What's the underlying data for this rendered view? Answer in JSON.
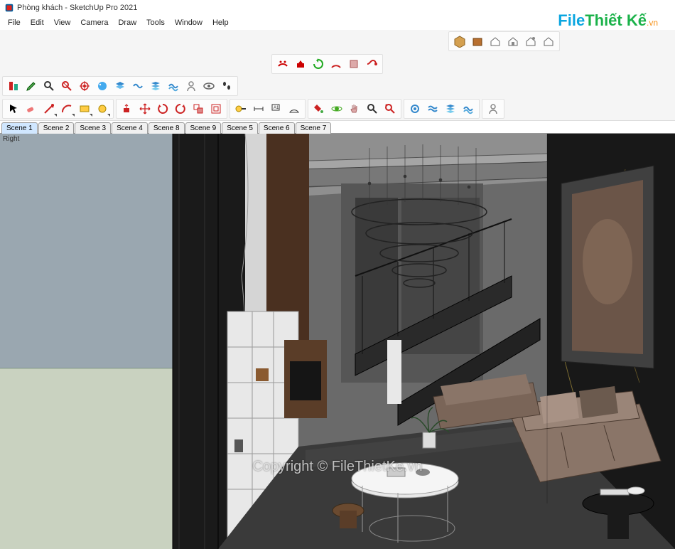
{
  "window": {
    "title": "Phòng khách - SketchUp Pro 2021"
  },
  "menu": {
    "items": [
      "File",
      "Edit",
      "View",
      "Camera",
      "Draw",
      "Tools",
      "Window",
      "Help"
    ]
  },
  "toolbars": {
    "row1_groups": [
      [
        "warehouse-3d-icon",
        "extension-warehouse-icon",
        "house-white-icon",
        "house-open-icon",
        "house-share-icon",
        "house-outline-icon"
      ]
    ],
    "row2_groups": [
      [
        "sandbox-smoove-icon",
        "sandbox-stamp-icon",
        "rotate-green-icon",
        "arc-red-icon",
        "box-icon",
        "followme-icon"
      ],
      [
        "align-icon",
        "pencil-red-icon",
        "zoom-icon",
        "intersect-icon",
        "target-icon",
        "palette-icon",
        "layers-icon",
        "outliner-icon",
        "layers2-icon",
        "layers3-icon",
        "person-icon",
        "eye-icon",
        "footprints-icon"
      ]
    ],
    "row3_groups": [
      [
        "select-arrow-icon",
        "eraser-icon",
        "pencil-tool-icon",
        "arc-tool-icon",
        "rectangle-icon",
        "circle-icon"
      ],
      [
        "pushpull-icon",
        "move-red-icon",
        "rotate-red-icon",
        "rotate2-icon",
        "scale-icon",
        "offset-icon"
      ],
      [
        "tape-icon",
        "dimension-icon",
        "text-label-icon",
        "protractor-icon"
      ],
      [
        "paint-icon",
        "orbit-icon",
        "pan-icon",
        "zoom2-icon",
        "zoom-extents-icon"
      ],
      [
        "shadow-icon",
        "fog-icon",
        "section-icon",
        "section-cut-icon"
      ],
      [
        "avatar-icon"
      ]
    ]
  },
  "scenes": {
    "tabs": [
      "Scene 1",
      "Scene 2",
      "Scene 3",
      "Scene 4",
      "Scene 8",
      "Scene 9",
      "Scene 5",
      "Scene 6",
      "Scene 7"
    ],
    "active_index": 0
  },
  "viewport": {
    "axis_label": "Right"
  },
  "watermark": {
    "brand_part1": "File",
    "brand_part2": "Thiết Kế",
    "brand_suffix": ".vn",
    "copyright": "Copyright © FileThietKe.vn"
  }
}
